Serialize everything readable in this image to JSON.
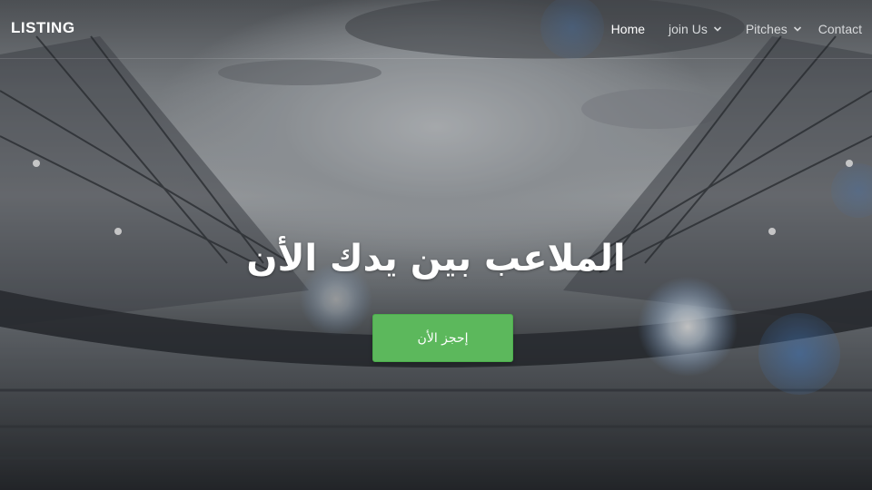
{
  "brand": {
    "name": "LISTING"
  },
  "nav": {
    "items": [
      {
        "label": "Home",
        "active": true,
        "has_dropdown": false
      },
      {
        "label": "join Us",
        "active": false,
        "has_dropdown": true
      },
      {
        "label": "Pitches",
        "active": false,
        "has_dropdown": true
      },
      {
        "label": "Contact",
        "active": false,
        "has_dropdown": false
      }
    ]
  },
  "hero": {
    "title": "الملاعب بين يدك الأن",
    "cta_label": "إحجز الأن",
    "background_icon": "stadium-image"
  },
  "colors": {
    "cta": "#5cb85c",
    "text": "#ffffff",
    "nav_text": "#d7d9db"
  }
}
